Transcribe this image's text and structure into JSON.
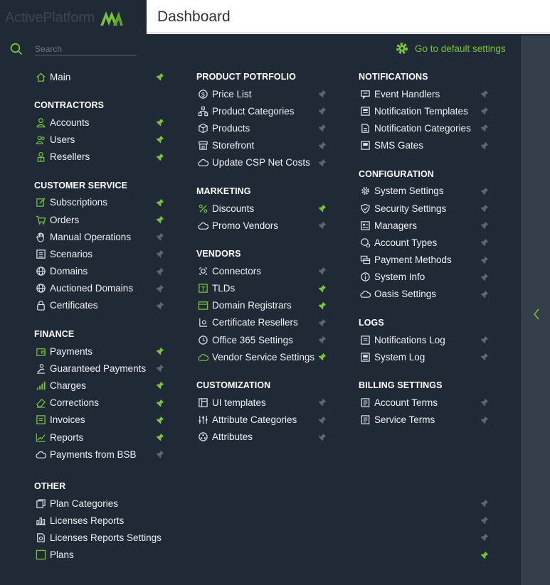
{
  "app": {
    "logo_text": "ActivePlatform",
    "page_title": "Dashboard"
  },
  "search": {
    "placeholder": "Search",
    "value": ""
  },
  "default_settings_label": "Go to default settings",
  "colors": {
    "accent": "#79c23a",
    "bg": "#1f2a36",
    "pin_inactive": "#5c6774"
  },
  "columns": [
    {
      "sections": [
        {
          "title": "",
          "items": [
            {
              "label": "Main",
              "icon": "home-icon",
              "pinned": true
            }
          ]
        },
        {
          "title": "CONTRACTORS",
          "items": [
            {
              "label": "Accounts",
              "icon": "user-icon",
              "pinned": true
            },
            {
              "label": "Users",
              "icon": "users-icon",
              "pinned": true
            },
            {
              "label": "Resellers",
              "icon": "reseller-icon",
              "pinned": true
            }
          ]
        },
        {
          "title": "CUSTOMER SERVICE",
          "items": [
            {
              "label": "Subscriptions",
              "icon": "edit-icon",
              "pinned": true
            },
            {
              "label": "Orders",
              "icon": "cart-icon",
              "pinned": true
            },
            {
              "label": "Manual Operations",
              "icon": "hand-icon",
              "pinned": false
            },
            {
              "label": "Scenarios",
              "icon": "list-icon",
              "pinned": false
            },
            {
              "label": "Domains",
              "icon": "globe-icon",
              "pinned": false
            },
            {
              "label": "Auctioned Domains",
              "icon": "globe-icon",
              "pinned": false
            },
            {
              "label": "Certificates",
              "icon": "lock-icon",
              "pinned": false
            }
          ]
        },
        {
          "title": "FINANCE",
          "items": [
            {
              "label": "Payments",
              "icon": "wallet-icon",
              "pinned": true
            },
            {
              "label": "Guaranteed Payments",
              "icon": "guarantee-icon",
              "pinned": false
            },
            {
              "label": "Charges",
              "icon": "bars-icon",
              "pinned": true
            },
            {
              "label": "Corrections",
              "icon": "eraser-icon",
              "pinned": true
            },
            {
              "label": "Invoices",
              "icon": "invoice-icon",
              "pinned": true
            },
            {
              "label": "Reports",
              "icon": "chart-icon",
              "pinned": true
            },
            {
              "label": "Payments from BSB",
              "icon": "cloud-icon",
              "pinned": false
            }
          ]
        }
      ]
    },
    {
      "sections": [
        {
          "title": "PRODUCT POTRFOLIO",
          "items": [
            {
              "label": "Price List",
              "icon": "dollar-icon",
              "pinned": false
            },
            {
              "label": "Product Categories",
              "icon": "hierarchy-icon",
              "pinned": false
            },
            {
              "label": "Products",
              "icon": "box-icon",
              "pinned": false
            },
            {
              "label": "Storefront",
              "icon": "store-icon",
              "pinned": false
            },
            {
              "label": "Update CSP Net Costs",
              "icon": "cloud-icon",
              "pinned": false
            }
          ]
        },
        {
          "title": "MARKETING",
          "items": [
            {
              "label": "Discounts",
              "icon": "percent-icon",
              "pinned": true
            },
            {
              "label": "Promo Vendors",
              "icon": "cloud-icon",
              "pinned": false
            }
          ]
        },
        {
          "title": "VENDORS",
          "items": [
            {
              "label": "Connectors",
              "icon": "connector-icon",
              "pinned": false
            },
            {
              "label": "TLDs",
              "icon": "tld-icon",
              "pinned": true
            },
            {
              "label": "Domain Registrars",
              "icon": "registrar-icon",
              "pinned": true
            },
            {
              "label": "Certificate Resellers",
              "icon": "certificate-icon",
              "pinned": false
            },
            {
              "label": "Office 365 Settings",
              "icon": "office-icon",
              "pinned": false
            },
            {
              "label": "Vendor Service Settings",
              "icon": "cloud-green-icon",
              "pinned": true
            }
          ]
        },
        {
          "title": "CUSTOMIZATION",
          "items": [
            {
              "label": "UI templates",
              "icon": "template-icon",
              "pinned": false
            },
            {
              "label": "Attribute Categories",
              "icon": "sliders-icon",
              "pinned": false
            },
            {
              "label": "Attributes",
              "icon": "attribute-icon",
              "pinned": false
            }
          ]
        }
      ]
    },
    {
      "sections": [
        {
          "title": "NOTIFICATIONS",
          "items": [
            {
              "label": "Event Handlers",
              "icon": "message-icon",
              "pinned": false
            },
            {
              "label": "Notification Templates",
              "icon": "template-doc-icon",
              "pinned": false
            },
            {
              "label": "Notification Categories",
              "icon": "doc-list-icon",
              "pinned": false
            },
            {
              "label": "SMS Gates",
              "icon": "sms-icon",
              "pinned": false
            }
          ]
        },
        {
          "title": "CONFIGURATION",
          "items": [
            {
              "label": "System Settings",
              "icon": "gear-icon",
              "pinned": false
            },
            {
              "label": "Security Settings",
              "icon": "shield-icon",
              "pinned": false
            },
            {
              "label": "Managers",
              "icon": "managers-icon",
              "pinned": false
            },
            {
              "label": "Account Types",
              "icon": "account-type-icon",
              "pinned": false
            },
            {
              "label": "Payment Methods",
              "icon": "payment-method-icon",
              "pinned": false
            },
            {
              "label": "System Info",
              "icon": "info-icon",
              "pinned": false
            },
            {
              "label": "Oasis Settings",
              "icon": "cloud-icon",
              "pinned": false
            }
          ]
        },
        {
          "title": "LOGS",
          "items": [
            {
              "label": "Notifications Log",
              "icon": "log-icon",
              "pinned": false
            },
            {
              "label": "System Log",
              "icon": "system-log-icon",
              "pinned": false
            }
          ]
        },
        {
          "title": "BILLING SETTINGS",
          "items": [
            {
              "label": "Account Terms",
              "icon": "terms-icon",
              "pinned": false
            },
            {
              "label": "Service Terms",
              "icon": "terms-icon",
              "pinned": false
            }
          ]
        }
      ]
    }
  ],
  "other": {
    "title": "OTHER",
    "items": [
      {
        "label": "Plan Categories",
        "icon": "plan-category-icon",
        "pinned": false
      },
      {
        "label": "Licenses Reports",
        "icon": "license-report-icon",
        "pinned": false
      },
      {
        "label": "Licenses Reports Settings",
        "icon": "license-settings-icon",
        "pinned": false
      },
      {
        "label": "Plans",
        "icon": "plans-icon",
        "pinned": true
      }
    ]
  }
}
